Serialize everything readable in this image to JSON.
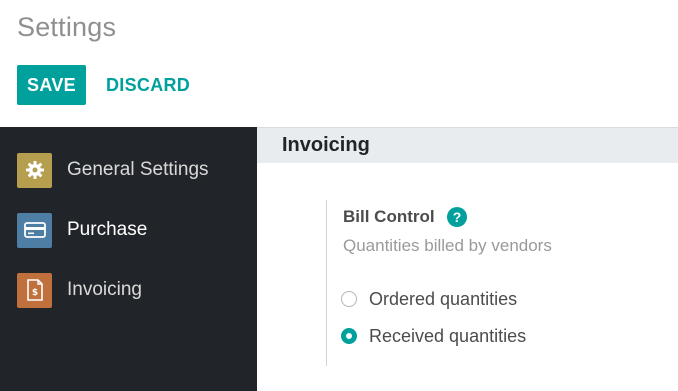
{
  "header": {
    "title": "Settings",
    "save_label": "SAVE",
    "discard_label": "DISCARD"
  },
  "sidebar": {
    "items": [
      {
        "label": "General Settings",
        "icon": "gear-icon",
        "color": "#b69e4f",
        "active": false
      },
      {
        "label": "Purchase",
        "icon": "credit-card-icon",
        "color": "#4e7ea3",
        "active": true
      },
      {
        "label": "Invoicing",
        "icon": "invoice-icon",
        "color": "#c0703c",
        "active": false
      }
    ]
  },
  "main": {
    "section_title": "Invoicing",
    "setting": {
      "title": "Bill Control",
      "help_icon": "question-circle-icon",
      "help_symbol": "?",
      "description": "Quantities billed by vendors",
      "options": [
        {
          "label": "Ordered quantities",
          "selected": false
        },
        {
          "label": "Received quantities",
          "selected": true
        }
      ]
    }
  },
  "colors": {
    "accent": "#00a09d",
    "sidebar_bg": "#212529",
    "section_header_bg": "#e9ecef"
  }
}
